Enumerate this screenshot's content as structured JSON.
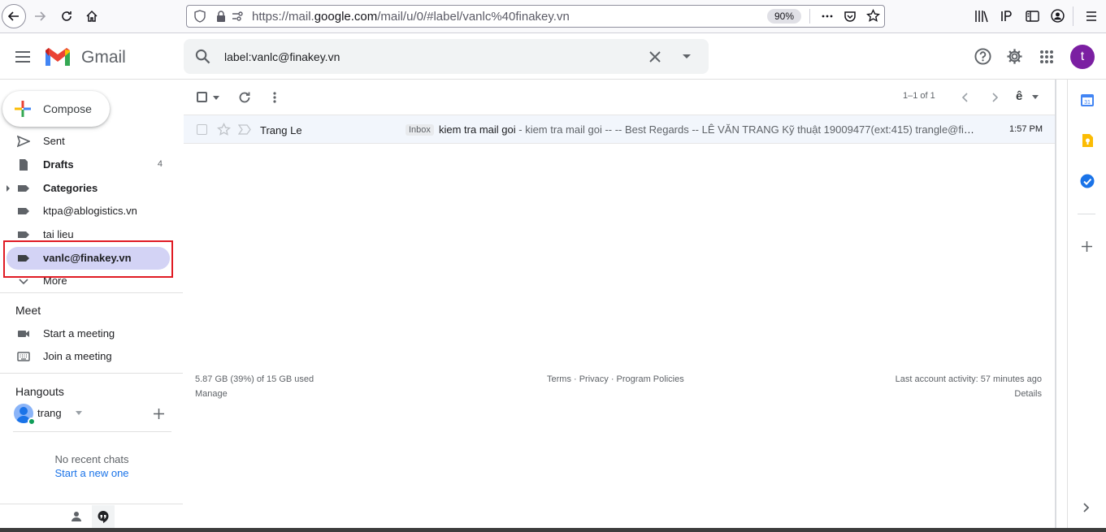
{
  "browser": {
    "url_prefix": "https://mail.",
    "url_domain": "google.com",
    "url_path": "/mail/u/0/#label/vanlc%40finakey.vn",
    "zoom": "90%"
  },
  "header": {
    "app_name": "Gmail",
    "search_query": "label:vanlc@finakey.vn",
    "avatar_letter": "t"
  },
  "sidebar": {
    "compose_label": "Compose",
    "items": [
      {
        "label": "Sent",
        "count": ""
      },
      {
        "label": "Drafts",
        "count": "4"
      },
      {
        "label": "Categories",
        "count": ""
      },
      {
        "label": "ktpa@ablogistics.vn",
        "count": ""
      },
      {
        "label": "tai lieu",
        "count": ""
      },
      {
        "label": "vanlc@finakey.vn",
        "count": ""
      },
      {
        "label": "More",
        "count": ""
      }
    ],
    "meet": {
      "title": "Meet",
      "start": "Start a meeting",
      "join": "Join a meeting"
    },
    "hangouts": {
      "title": "Hangouts",
      "user": "trang",
      "no_chats": "No recent chats",
      "start_new": "Start a new one"
    }
  },
  "toolbar": {
    "pagination": "1–1 of 1"
  },
  "emails": [
    {
      "sender": "Trang Le",
      "badge": "Inbox",
      "subject": "kiem tra mail goi",
      "snippet": " - kiem tra mail goi -- -- Best Regards -- LÊ VĂN TRANG Kỹ thuật 19009477(ext:415) trangle@finakey.vn",
      "time": "1:57 PM"
    }
  ],
  "footer": {
    "storage": "5.87 GB (39%) of 15 GB used",
    "manage": "Manage",
    "links": "Terms · Privacy · Program Policies",
    "activity": "Last account activity: 57 minutes ago",
    "details": "Details"
  },
  "colors": {
    "selected_label_bg": "#d3d3f5",
    "highlight_box": "#e01b24",
    "avatar_bg": "#7b1fa2",
    "link_blue": "#1a73e8"
  }
}
